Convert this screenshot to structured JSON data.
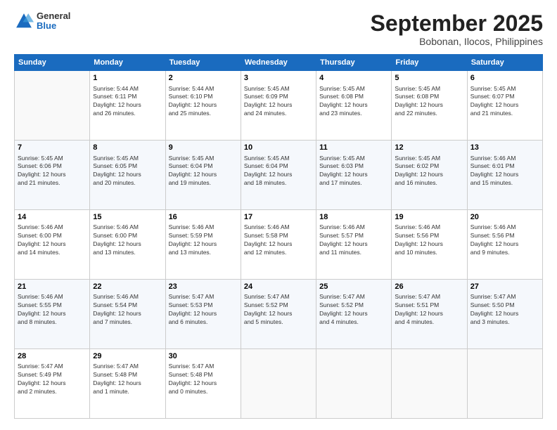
{
  "header": {
    "logo": {
      "general": "General",
      "blue": "Blue"
    },
    "title": "September 2025",
    "location": "Bobonan, Ilocos, Philippines"
  },
  "days_of_week": [
    "Sunday",
    "Monday",
    "Tuesday",
    "Wednesday",
    "Thursday",
    "Friday",
    "Saturday"
  ],
  "weeks": [
    [
      {
        "day": null
      },
      {
        "day": "1",
        "sunrise": "5:44 AM",
        "sunset": "6:11 PM",
        "daylight": "12 hours and 26 minutes."
      },
      {
        "day": "2",
        "sunrise": "5:44 AM",
        "sunset": "6:10 PM",
        "daylight": "12 hours and 25 minutes."
      },
      {
        "day": "3",
        "sunrise": "5:45 AM",
        "sunset": "6:09 PM",
        "daylight": "12 hours and 24 minutes."
      },
      {
        "day": "4",
        "sunrise": "5:45 AM",
        "sunset": "6:08 PM",
        "daylight": "12 hours and 23 minutes."
      },
      {
        "day": "5",
        "sunrise": "5:45 AM",
        "sunset": "6:08 PM",
        "daylight": "12 hours and 22 minutes."
      },
      {
        "day": "6",
        "sunrise": "5:45 AM",
        "sunset": "6:07 PM",
        "daylight": "12 hours and 21 minutes."
      }
    ],
    [
      {
        "day": "7",
        "sunrise": "5:45 AM",
        "sunset": "6:06 PM",
        "daylight": "12 hours and 21 minutes."
      },
      {
        "day": "8",
        "sunrise": "5:45 AM",
        "sunset": "6:05 PM",
        "daylight": "12 hours and 20 minutes."
      },
      {
        "day": "9",
        "sunrise": "5:45 AM",
        "sunset": "6:04 PM",
        "daylight": "12 hours and 19 minutes."
      },
      {
        "day": "10",
        "sunrise": "5:45 AM",
        "sunset": "6:04 PM",
        "daylight": "12 hours and 18 minutes."
      },
      {
        "day": "11",
        "sunrise": "5:45 AM",
        "sunset": "6:03 PM",
        "daylight": "12 hours and 17 minutes."
      },
      {
        "day": "12",
        "sunrise": "5:45 AM",
        "sunset": "6:02 PM",
        "daylight": "12 hours and 16 minutes."
      },
      {
        "day": "13",
        "sunrise": "5:46 AM",
        "sunset": "6:01 PM",
        "daylight": "12 hours and 15 minutes."
      }
    ],
    [
      {
        "day": "14",
        "sunrise": "5:46 AM",
        "sunset": "6:00 PM",
        "daylight": "12 hours and 14 minutes."
      },
      {
        "day": "15",
        "sunrise": "5:46 AM",
        "sunset": "6:00 PM",
        "daylight": "12 hours and 13 minutes."
      },
      {
        "day": "16",
        "sunrise": "5:46 AM",
        "sunset": "5:59 PM",
        "daylight": "12 hours and 13 minutes."
      },
      {
        "day": "17",
        "sunrise": "5:46 AM",
        "sunset": "5:58 PM",
        "daylight": "12 hours and 12 minutes."
      },
      {
        "day": "18",
        "sunrise": "5:46 AM",
        "sunset": "5:57 PM",
        "daylight": "12 hours and 11 minutes."
      },
      {
        "day": "19",
        "sunrise": "5:46 AM",
        "sunset": "5:56 PM",
        "daylight": "12 hours and 10 minutes."
      },
      {
        "day": "20",
        "sunrise": "5:46 AM",
        "sunset": "5:56 PM",
        "daylight": "12 hours and 9 minutes."
      }
    ],
    [
      {
        "day": "21",
        "sunrise": "5:46 AM",
        "sunset": "5:55 PM",
        "daylight": "12 hours and 8 minutes."
      },
      {
        "day": "22",
        "sunrise": "5:46 AM",
        "sunset": "5:54 PM",
        "daylight": "12 hours and 7 minutes."
      },
      {
        "day": "23",
        "sunrise": "5:47 AM",
        "sunset": "5:53 PM",
        "daylight": "12 hours and 6 minutes."
      },
      {
        "day": "24",
        "sunrise": "5:47 AM",
        "sunset": "5:52 PM",
        "daylight": "12 hours and 5 minutes."
      },
      {
        "day": "25",
        "sunrise": "5:47 AM",
        "sunset": "5:52 PM",
        "daylight": "12 hours and 4 minutes."
      },
      {
        "day": "26",
        "sunrise": "5:47 AM",
        "sunset": "5:51 PM",
        "daylight": "12 hours and 4 minutes."
      },
      {
        "day": "27",
        "sunrise": "5:47 AM",
        "sunset": "5:50 PM",
        "daylight": "12 hours and 3 minutes."
      }
    ],
    [
      {
        "day": "28",
        "sunrise": "5:47 AM",
        "sunset": "5:49 PM",
        "daylight": "12 hours and 2 minutes."
      },
      {
        "day": "29",
        "sunrise": "5:47 AM",
        "sunset": "5:48 PM",
        "daylight": "12 hours and 1 minute."
      },
      {
        "day": "30",
        "sunrise": "5:47 AM",
        "sunset": "5:48 PM",
        "daylight": "12 hours and 0 minutes."
      },
      {
        "day": null
      },
      {
        "day": null
      },
      {
        "day": null
      },
      {
        "day": null
      }
    ]
  ]
}
